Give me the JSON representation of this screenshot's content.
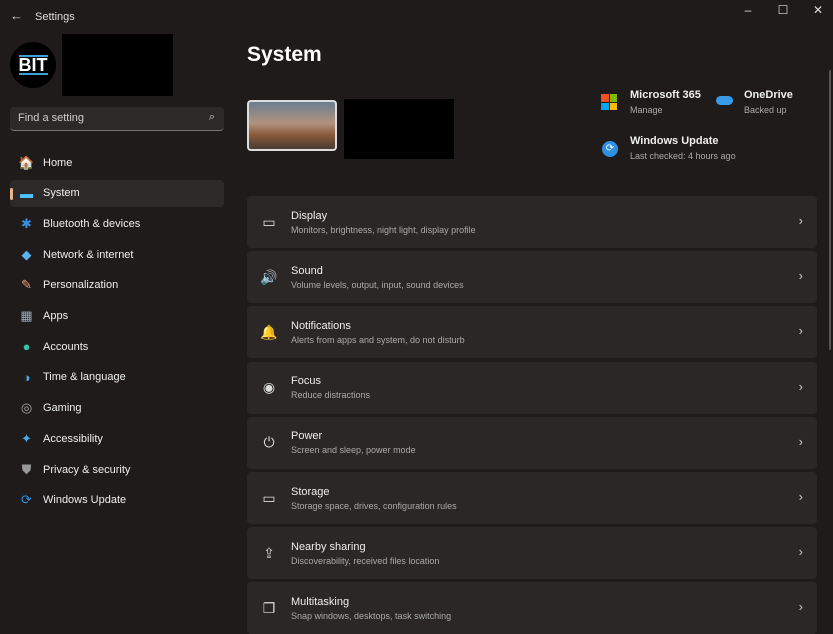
{
  "window": {
    "title": "Settings",
    "back_icon": "arrow-left-icon"
  },
  "profile": {
    "avatar_text": "BIT"
  },
  "search": {
    "placeholder": "Find a setting"
  },
  "sidebar": {
    "items": [
      {
        "label": "Home",
        "icon": "🏠",
        "color": "#e8a070"
      },
      {
        "label": "System",
        "icon": "▬",
        "color": "#4fc3f7",
        "selected": true
      },
      {
        "label": "Bluetooth & devices",
        "icon": "✱",
        "color": "#3a8ee6"
      },
      {
        "label": "Network & internet",
        "icon": "◆",
        "color": "#5ab0f0"
      },
      {
        "label": "Personalization",
        "icon": "✎",
        "color": "#e8a070"
      },
      {
        "label": "Apps",
        "icon": "▦",
        "color": "#9ab"
      },
      {
        "label": "Accounts",
        "icon": "●",
        "color": "#3cc0a0"
      },
      {
        "label": "Time & language",
        "icon": "◑",
        "color": "#4aa8e0"
      },
      {
        "label": "Gaming",
        "icon": "◎",
        "color": "#aaa"
      },
      {
        "label": "Accessibility",
        "icon": "✦",
        "color": "#4aa8e0"
      },
      {
        "label": "Privacy & security",
        "icon": "⛊",
        "color": "#999"
      },
      {
        "label": "Windows Update",
        "icon": "⟳",
        "color": "#2f8fe0"
      }
    ]
  },
  "main": {
    "title": "System",
    "quick": [
      {
        "title": "Microsoft 365",
        "sub": "Manage"
      },
      {
        "title": "OneDrive",
        "sub": "Backed up"
      },
      {
        "title": "Windows Update",
        "sub": "Last checked: 4 hours ago"
      }
    ],
    "cards": [
      {
        "title": "Display",
        "sub": "Monitors, brightness, night light, display profile",
        "icon": "▭"
      },
      {
        "title": "Sound",
        "sub": "Volume levels, output, input, sound devices",
        "icon": "🔊"
      },
      {
        "title": "Notifications",
        "sub": "Alerts from apps and system, do not disturb",
        "icon": "🔔"
      },
      {
        "title": "Focus",
        "sub": "Reduce distractions",
        "icon": "◉"
      },
      {
        "title": "Power",
        "sub": "Screen and sleep, power mode",
        "icon": "⏻"
      },
      {
        "title": "Storage",
        "sub": "Storage space, drives, configuration rules",
        "icon": "▭"
      },
      {
        "title": "Nearby sharing",
        "sub": "Discoverability, received files location",
        "icon": "⇪"
      },
      {
        "title": "Multitasking",
        "sub": "Snap windows, desktops, task switching",
        "icon": "❐"
      }
    ]
  }
}
